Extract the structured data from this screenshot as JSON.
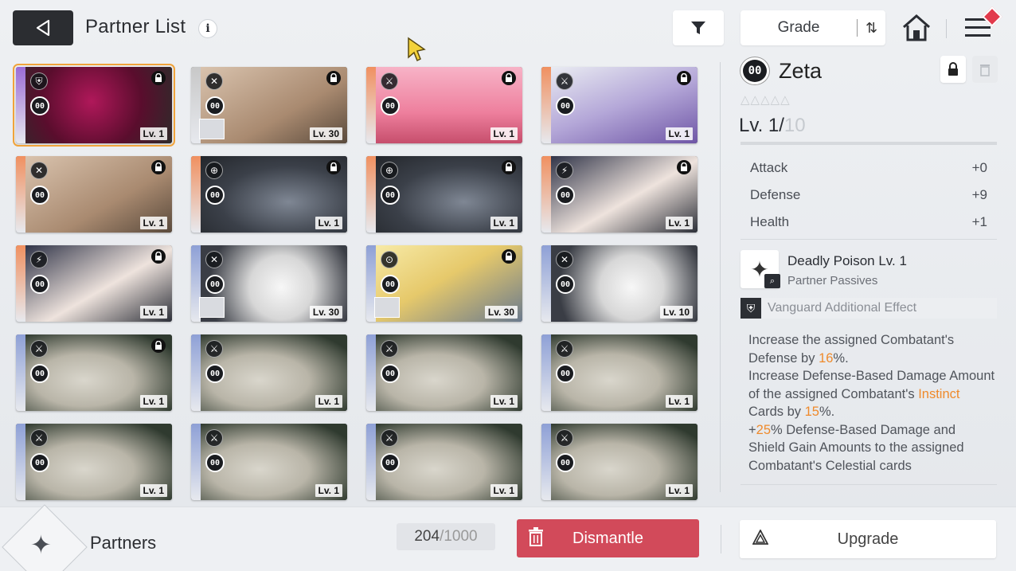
{
  "header": {
    "title": "Partner List",
    "info_icon": "i",
    "grade_label": "Grade",
    "sort_icon": "⇅"
  },
  "cards": [
    {
      "art": "red",
      "stripe": "#9b6bd6",
      "class_icon": "⛨",
      "grade": "00",
      "locked": true,
      "level": "Lv. 1",
      "thumb": false,
      "selected": true
    },
    {
      "art": "brown",
      "stripe": "#c8c8c8",
      "class_icon": "✕",
      "grade": "00",
      "locked": true,
      "level": "Lv. 30",
      "thumb": true,
      "selected": false
    },
    {
      "art": "pink",
      "stripe": "#f09060",
      "class_icon": "⚔",
      "grade": "00",
      "locked": true,
      "level": "Lv. 1",
      "thumb": false,
      "selected": false
    },
    {
      "art": "purple",
      "stripe": "#f09060",
      "class_icon": "⚔",
      "grade": "00",
      "locked": true,
      "level": "Lv. 1",
      "thumb": false,
      "selected": false
    },
    {
      "art": "brown",
      "stripe": "#f09060",
      "class_icon": "✕",
      "grade": "00",
      "locked": true,
      "level": "Lv. 1",
      "thumb": false,
      "selected": false
    },
    {
      "art": "mech",
      "stripe": "#f09060",
      "class_icon": "⊕",
      "grade": "00",
      "locked": true,
      "level": "Lv. 1",
      "thumb": false,
      "selected": false
    },
    {
      "art": "mech",
      "stripe": "#f09060",
      "class_icon": "⊕",
      "grade": "00",
      "locked": true,
      "level": "Lv. 1",
      "thumb": false,
      "selected": false
    },
    {
      "art": "dhair",
      "stripe": "#f09060",
      "class_icon": "⚡",
      "grade": "00",
      "locked": true,
      "level": "Lv. 1",
      "thumb": false,
      "selected": false
    },
    {
      "art": "dhair",
      "stripe": "#f09060",
      "class_icon": "⚡",
      "grade": "00",
      "locked": true,
      "level": "Lv. 1",
      "thumb": false,
      "selected": false
    },
    {
      "art": "bunny",
      "stripe": "#8ea0d6",
      "class_icon": "✕",
      "grade": "00",
      "locked": false,
      "level": "Lv. 30",
      "thumb": true,
      "selected": false
    },
    {
      "art": "blonde",
      "stripe": "#8ea0d6",
      "class_icon": "⊙",
      "grade": "00",
      "locked": true,
      "level": "Lv. 30",
      "thumb": true,
      "selected": false
    },
    {
      "art": "bunny",
      "stripe": "#8ea0d6",
      "class_icon": "✕",
      "grade": "00",
      "locked": false,
      "level": "Lv. 10",
      "thumb": false,
      "selected": false
    },
    {
      "art": "grey",
      "stripe": "#8ea0d6",
      "class_icon": "⚔",
      "grade": "00",
      "locked": true,
      "level": "Lv. 1",
      "thumb": false,
      "selected": false
    },
    {
      "art": "grey",
      "stripe": "#8ea0d6",
      "class_icon": "⚔",
      "grade": "00",
      "locked": false,
      "level": "Lv. 1",
      "thumb": false,
      "selected": false
    },
    {
      "art": "grey",
      "stripe": "#8ea0d6",
      "class_icon": "⚔",
      "grade": "00",
      "locked": false,
      "level": "Lv. 1",
      "thumb": false,
      "selected": false
    },
    {
      "art": "grey",
      "stripe": "#8ea0d6",
      "class_icon": "⚔",
      "grade": "00",
      "locked": false,
      "level": "Lv. 1",
      "thumb": false,
      "selected": false
    },
    {
      "art": "grey",
      "stripe": "#8ea0d6",
      "class_icon": "⚔",
      "grade": "00",
      "locked": false,
      "level": "Lv. 1",
      "thumb": false,
      "selected": false
    },
    {
      "art": "grey",
      "stripe": "#8ea0d6",
      "class_icon": "⚔",
      "grade": "00",
      "locked": false,
      "level": "Lv. 1",
      "thumb": false,
      "selected": false
    },
    {
      "art": "grey",
      "stripe": "#8ea0d6",
      "class_icon": "⚔",
      "grade": "00",
      "locked": false,
      "level": "Lv. 1",
      "thumb": false,
      "selected": false
    },
    {
      "art": "grey",
      "stripe": "#8ea0d6",
      "class_icon": "⚔",
      "grade": "00",
      "locked": false,
      "level": "Lv. 1",
      "thumb": false,
      "selected": false
    }
  ],
  "detail": {
    "grade": "00",
    "name": "Zeta",
    "stars": "△△△△△",
    "level_current": "Lv. 1/",
    "level_max": "10",
    "stats": [
      {
        "label": "Attack",
        "value": "+0"
      },
      {
        "label": "Defense",
        "value": "+9"
      },
      {
        "label": "Health",
        "value": "+1"
      }
    ],
    "skill_name": "Deadly Poison Lv. 1",
    "skill_type": "Partner Passives",
    "vanguard_label": "Vanguard Additional Effect",
    "desc": {
      "p1a": "Increase the assigned Combatant's Defense by ",
      "p1b": "16",
      "p1c": "%.",
      "p2a": "Increase Defense-Based Damage Amount of the assigned Combatant's ",
      "p2b": "Instinct",
      "p2c": " Cards by ",
      "p2d": "15",
      "p2e": "%.",
      "p3a": "+",
      "p3b": "25",
      "p3c": "% Defense-Based Damage and Shield Gain Amounts to the assigned Combatant's Celestial cards"
    }
  },
  "footer": {
    "title": "Partners",
    "count_current": "204",
    "count_sep": " / ",
    "count_total": "1000",
    "dismantle_label": "Dismantle",
    "upgrade_label": "Upgrade"
  },
  "colors": {
    "accent_selected": "#f0a33b",
    "dismantle": "#d24a5a",
    "highlight": "#ef8a2b"
  }
}
